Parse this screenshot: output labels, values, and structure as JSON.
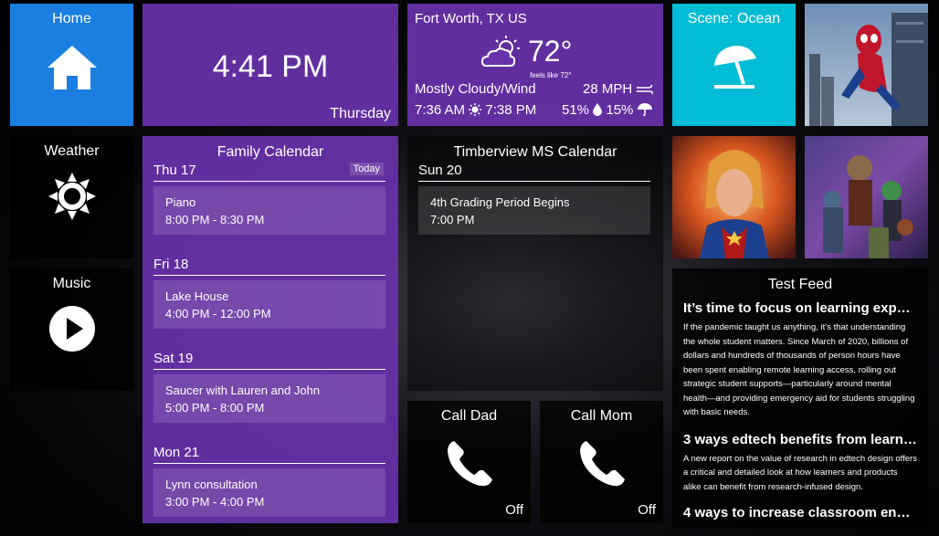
{
  "home": {
    "label": "Home"
  },
  "clock": {
    "time": "4:41 PM",
    "day": "Thursday"
  },
  "weather_tile": {
    "location": "Fort Worth, TX US",
    "temp": "72°",
    "feels_like": "feels like 72°",
    "condition": "Mostly Cloudy/Wind",
    "wind": "28 MPH",
    "sunrise": "7:36 AM",
    "sunset": "7:38 PM",
    "humidity": "51%",
    "precip": "15%",
    "icon": "partly-cloudy-icon"
  },
  "scene": {
    "label": "Scene: Ocean",
    "icon": "beach-umbrella-icon",
    "color": "#00bcd4"
  },
  "weather_button": {
    "label": "Weather"
  },
  "music_button": {
    "label": "Music"
  },
  "family_calendar": {
    "title": "Family Calendar",
    "days": [
      {
        "header": "Thu 17",
        "today": "Today",
        "events": [
          {
            "title": "Piano",
            "time": "8:00 PM - 8:30 PM"
          }
        ]
      },
      {
        "header": "Fri 18",
        "events": [
          {
            "title": "Lake House",
            "time": "4:00 PM - 12:00 PM"
          }
        ]
      },
      {
        "header": "Sat 19",
        "events": [
          {
            "title": "Saucer with Lauren and John",
            "time": "5:00 PM - 8:00 PM"
          }
        ]
      },
      {
        "header": "Mon 21",
        "events": [
          {
            "title": "Lynn consultation",
            "time": "3:00 PM - 4:00 PM"
          }
        ]
      }
    ]
  },
  "school_calendar": {
    "title": "Timberview MS Calendar",
    "days": [
      {
        "header": "Sun 20",
        "events": [
          {
            "title": "4th Grading Period Begins",
            "time": "7:00 PM"
          }
        ]
      }
    ]
  },
  "call_dad": {
    "label": "Call Dad",
    "state": "Off"
  },
  "call_mom": {
    "label": "Call Mom",
    "state": "Off"
  },
  "feed": {
    "title": "Test Feed",
    "items": [
      {
        "title": "It’s time to focus on learning exper...",
        "body": "If the pandemic taught us anything, it’s that understanding the whole student matters. Since March of 2020, billions of dollars and hundreds of thousands of person hours have been spent enabling remote learning access, rolling out strategic student supports—particularly around mental health—and providing emergency aid for students struggling with basic needs."
      },
      {
        "title": "3 ways edtech benefits from learni...",
        "body": "A new report on the value of research in edtech design offers a critical and detailed look at how learners and products alike can benefit from research-infused design."
      },
      {
        "title": "4 ways to increase classroom enga...",
        "body": ""
      }
    ]
  },
  "colors": {
    "purple": "#6832aa",
    "blue": "#1a7fe0",
    "teal": "#00bcd4"
  }
}
